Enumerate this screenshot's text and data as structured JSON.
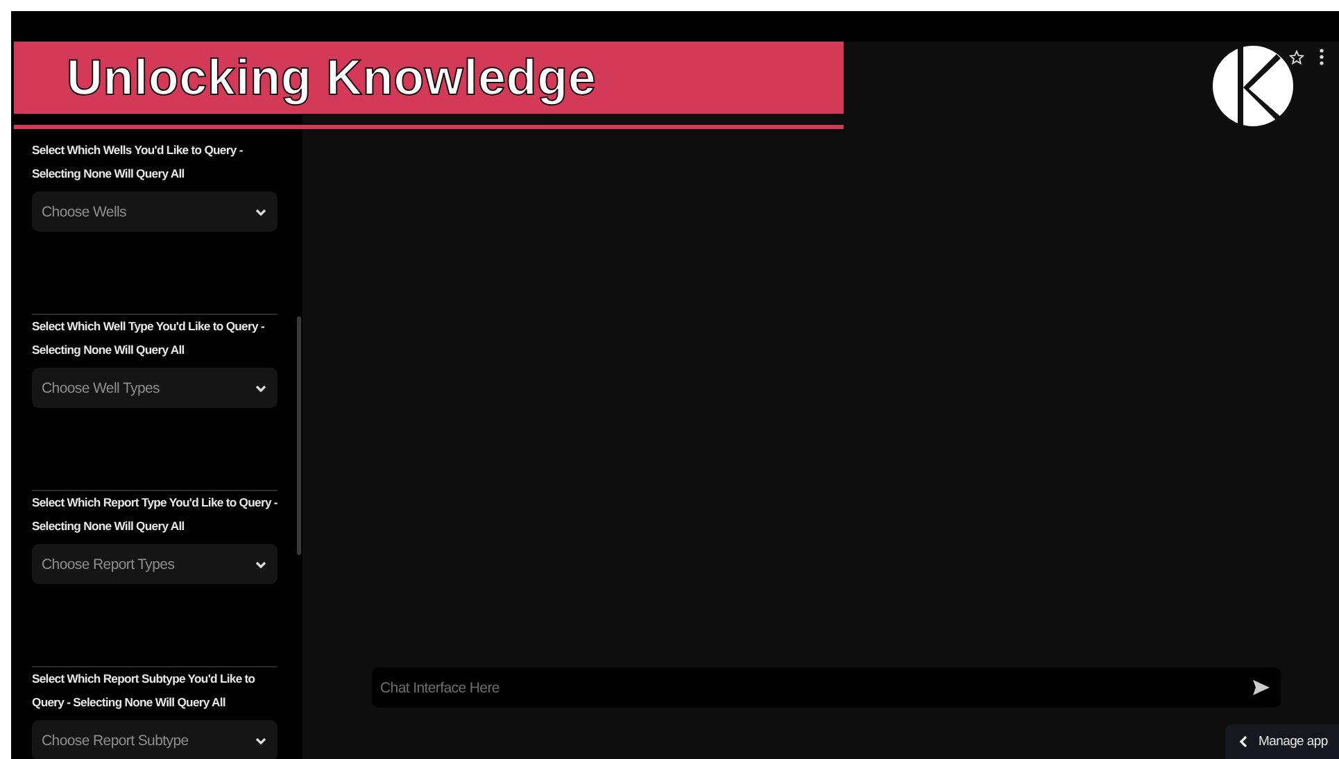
{
  "banner": {
    "title": "Unlocking Knowledge"
  },
  "sidebar": {
    "filters": [
      {
        "label": "Select Which Wells You'd Like to Query - Selecting None Will Query All",
        "placeholder": "Choose Wells"
      },
      {
        "label": "Select Which Well Type You'd Like to Query - Selecting None Will Query All",
        "placeholder": "Choose Well Types"
      },
      {
        "label": "Select Which Report Type You'd Like to Query - Selecting None Will Query All",
        "placeholder": "Choose Report Types"
      },
      {
        "label": "Select Which Report Subtype You'd Like to Query - Selecting None Will Query All",
        "placeholder": "Choose Report Subtype"
      }
    ]
  },
  "chat": {
    "placeholder": "Chat Interface Here"
  },
  "manage_app": {
    "label": "Manage app"
  }
}
